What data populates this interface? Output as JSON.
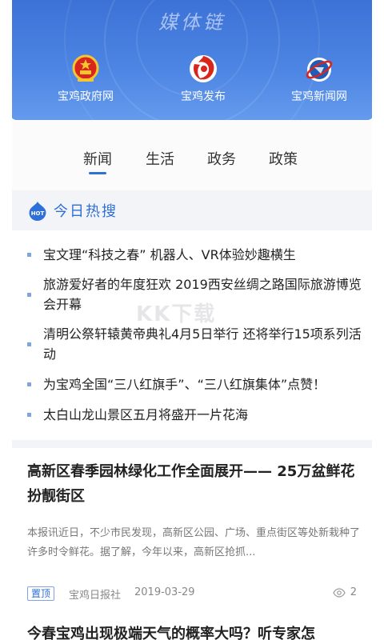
{
  "header": {
    "brand_title": "媒体链",
    "portals": [
      {
        "label": "宝鸡政府网",
        "icon": "national-emblem-icon"
      },
      {
        "label": "宝鸡发布",
        "icon": "red-swirl-logo-icon"
      },
      {
        "label": "宝鸡新闻网",
        "icon": "blue-globe-logo-icon"
      }
    ],
    "colors": {
      "banner": "#4d86e4",
      "accent": "#2f6fd8"
    }
  },
  "tabs": [
    {
      "label": "新闻",
      "active": true
    },
    {
      "label": "生活",
      "active": false
    },
    {
      "label": "政务",
      "active": false
    },
    {
      "label": "政策",
      "active": false
    }
  ],
  "hot_search": {
    "icon_text": "HOT",
    "title": "今日热搜",
    "items": [
      "宝文理“科技之春” 机器人、VR体验妙趣横生",
      "旅游爱好者的年度狂欢 2019西安丝绸之路国际旅游博览会开幕",
      "清明公祭轩辕黄帝典礼4月5日举行 还将举行15项系列活动",
      "为宝鸡全国“三八红旗手”、“三八红旗集体”点赞！",
      "太白山龙山景区五月将盛开一片花海"
    ]
  },
  "article": {
    "title": "高新区春季园林绿化工作全面展开—— 25万盆鲜花扮靓街区",
    "summary": "本报讯近日，不少市民发现，高新区公园、广场、重点街区等处新栽种了许多时令鲜花。据了解，今年以来，高新区抢抓...",
    "badge": "置顶",
    "source": "宝鸡日报社",
    "date": "2019-03-29",
    "views": "2"
  },
  "next_article": {
    "title": "今春宝鸡出现极端天气的概率大吗？听专家怎"
  },
  "watermark": "KK下载"
}
